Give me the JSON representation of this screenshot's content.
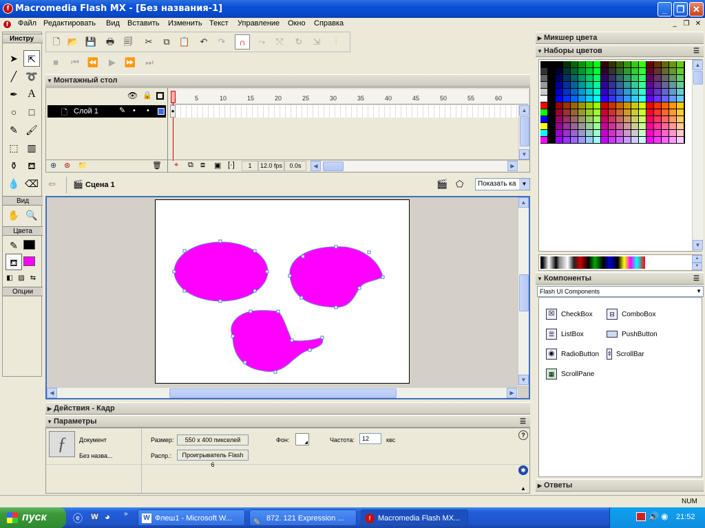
{
  "window": {
    "title": "Macromedia Flash MX - [Без названия-1]"
  },
  "menu": [
    "Файл",
    "Редактировать",
    "Вид",
    "Вставить",
    "Изменить",
    "Текст",
    "Управление",
    "Окно",
    "Справка"
  ],
  "tools": {
    "title": "Инстру",
    "view_title": "Вид",
    "colors_title": "Цвета",
    "options_title": "Опции",
    "stroke_color": "#000000",
    "fill_color": "#ff00ff"
  },
  "timeline": {
    "title": "Монтажный стол",
    "layer_name": "Слой 1",
    "ruler": [
      "1",
      "5",
      "10",
      "15",
      "20",
      "25",
      "30",
      "35",
      "40",
      "45",
      "50",
      "55",
      "60"
    ],
    "current_frame": "1",
    "fps": "12.0 fps",
    "time": "0.0s"
  },
  "scene": {
    "name": "Сцена 1",
    "zoom": "Показать ка"
  },
  "actions_panel": {
    "title": "Действия - Кадр"
  },
  "properties": {
    "title": "Параметры",
    "doc_label": "Документ",
    "doc_name": "Без назва...",
    "size_label": "Размер:",
    "size_value": "550 x 400 пикселей",
    "bg_label": "Фон:",
    "rate_label": "Частота:",
    "rate_value": "12",
    "rate_unit": "квс",
    "publish_label": "Распр.:",
    "publish_value": "Проигрыватель Flash 6"
  },
  "right": {
    "mixer_title": "Микшер цвета",
    "swatches_title": "Наборы цветов",
    "components_title": "Компоненты",
    "components_set": "Flash UI Components",
    "components": [
      "CheckBox",
      "ComboBox",
      "ListBox",
      "PushButton",
      "RadioButton",
      "ScrollBar",
      "ScrollPane"
    ],
    "answers_title": "Ответы"
  },
  "status": {
    "num": "NUM"
  },
  "taskbar": {
    "start": "пуск",
    "tasks": [
      "Флеш1 - Microsoft W...",
      "872. 121 Expression ...",
      "Macromedia Flash MX..."
    ],
    "lang": "RL",
    "clock": "21:52"
  },
  "shape_color": "#ff00ff"
}
